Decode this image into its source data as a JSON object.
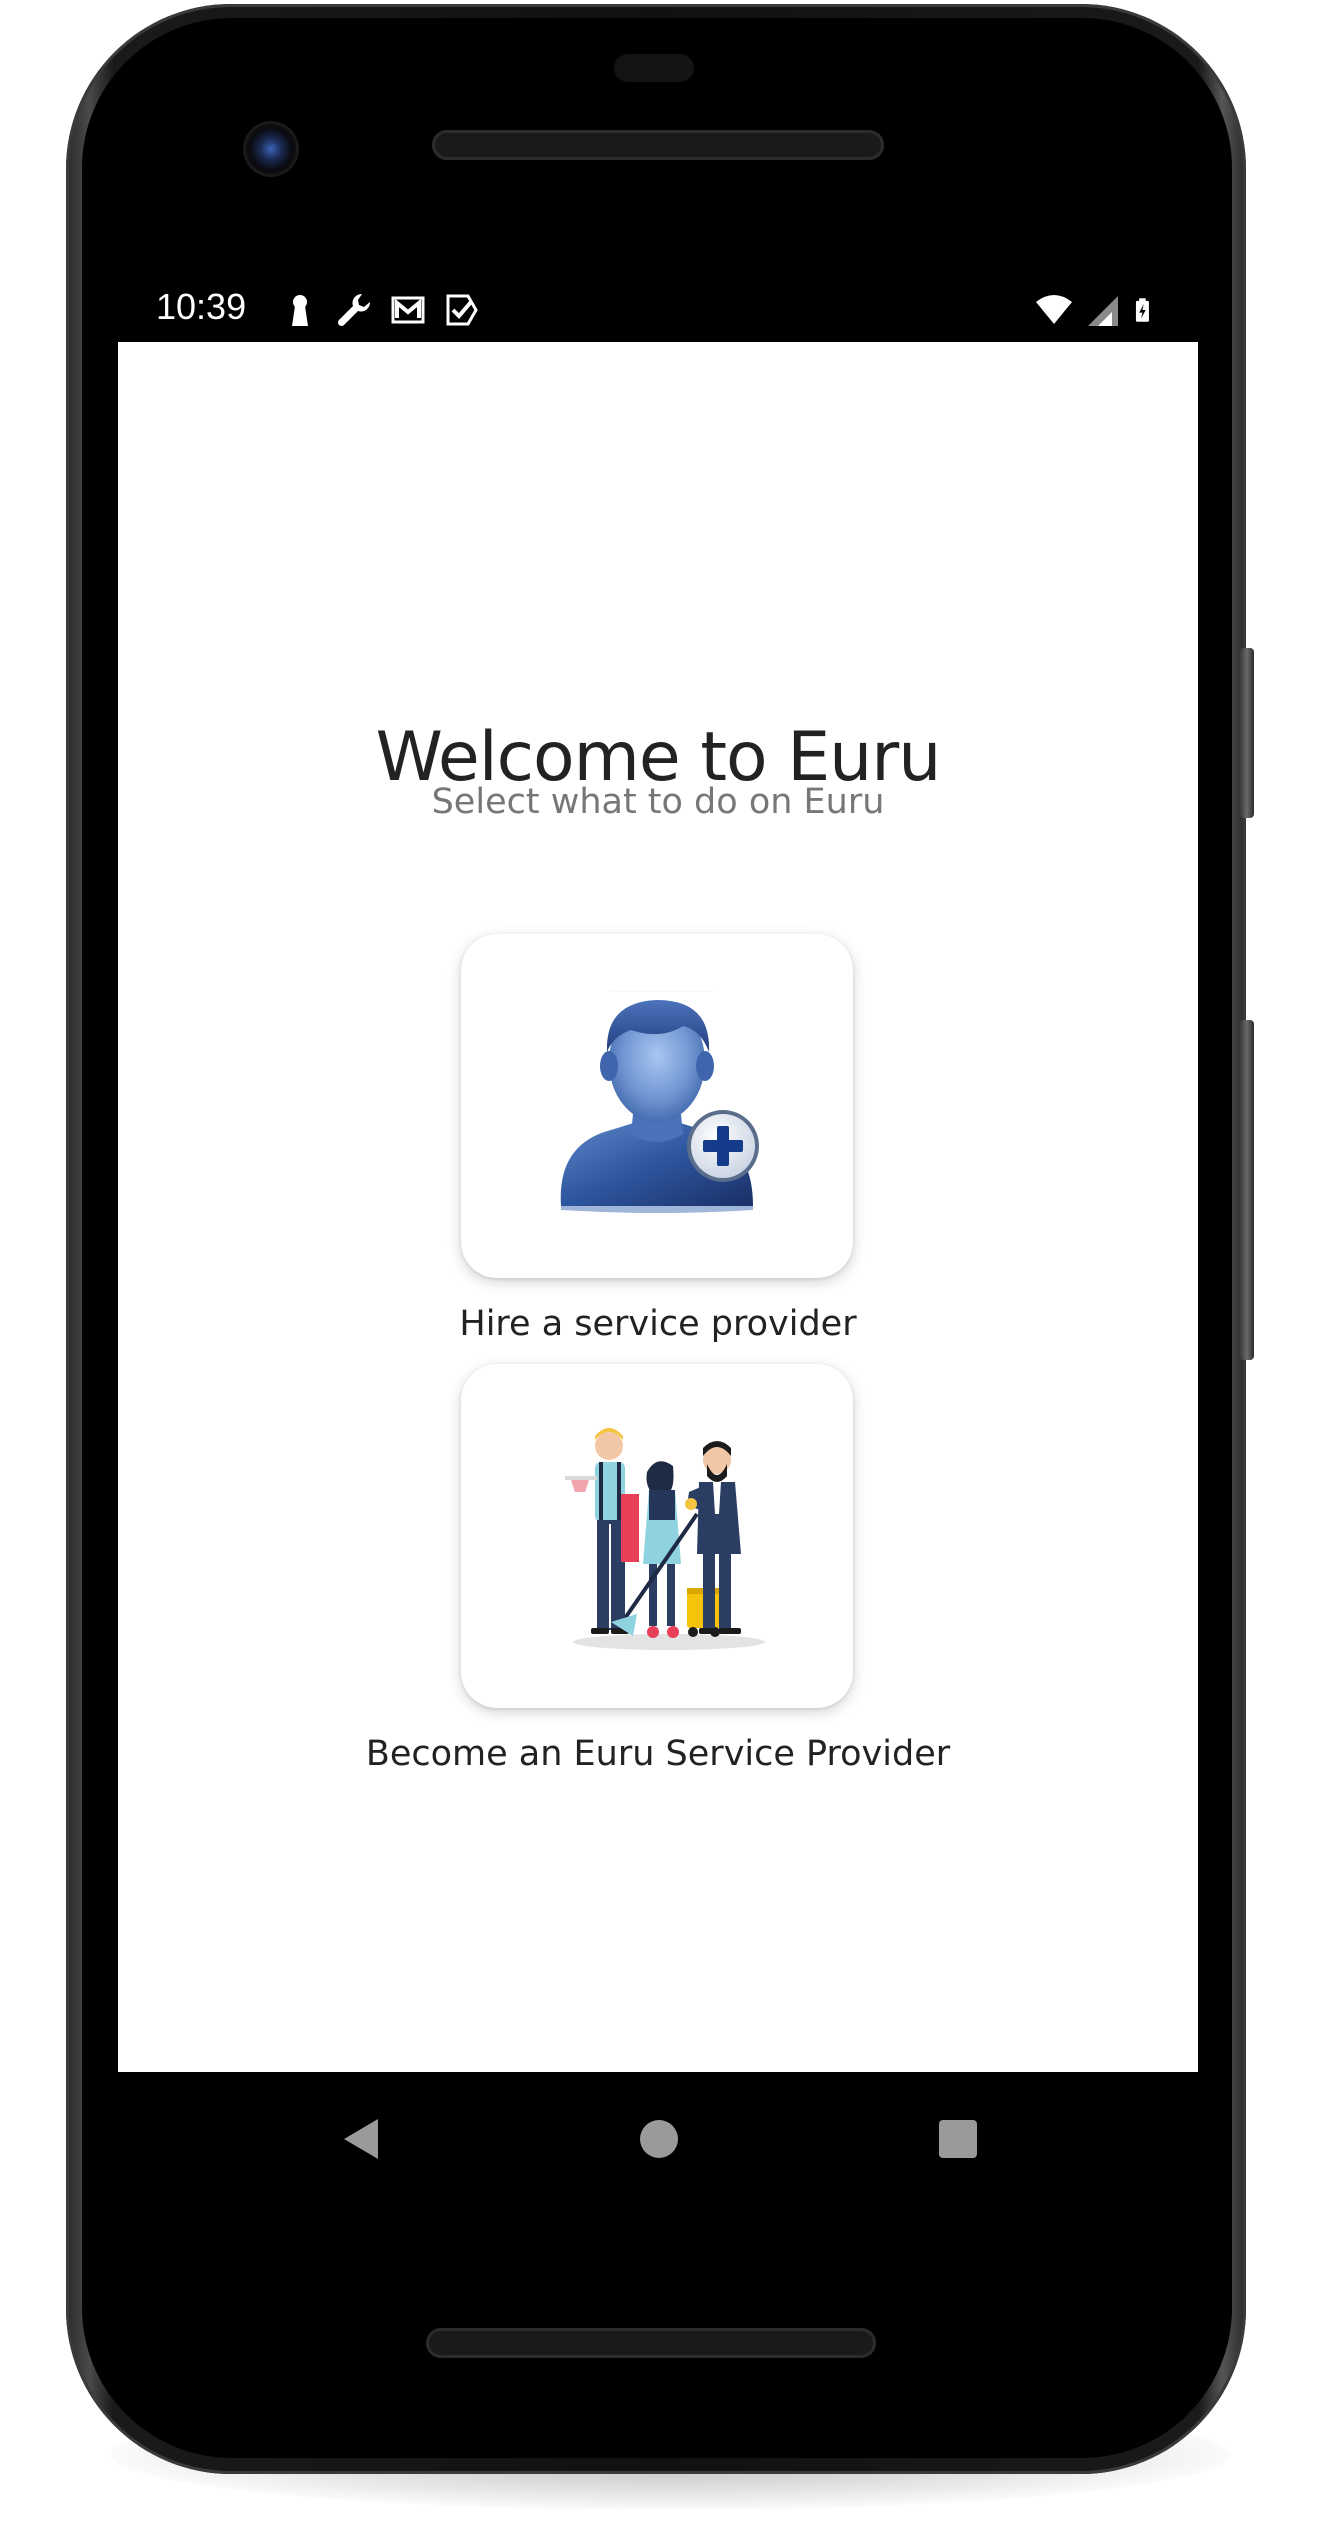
{
  "status_bar": {
    "time": "10:39",
    "left_icons": [
      "keyhole-icon",
      "wrench-icon",
      "mail-icon",
      "checkbox-icon"
    ],
    "right_icons": [
      "wifi-icon",
      "cell-signal-icon",
      "battery-charging-icon"
    ]
  },
  "welcome": {
    "title": "Welcome to Euru",
    "subtitle": "Select what to do on Euru"
  },
  "options": [
    {
      "label": "Hire a service provider",
      "icon": "add-user-icon"
    },
    {
      "label": "Become an Euru Service Provider",
      "icon": "service-workers-illustration"
    }
  ],
  "nav": {
    "back": "back-icon",
    "home": "home-icon",
    "recents": "recents-icon"
  },
  "colors": {
    "screen_background": "#ffffff",
    "title_text": "#222222",
    "subtitle_text": "#777777",
    "device_frame": "#000000"
  }
}
